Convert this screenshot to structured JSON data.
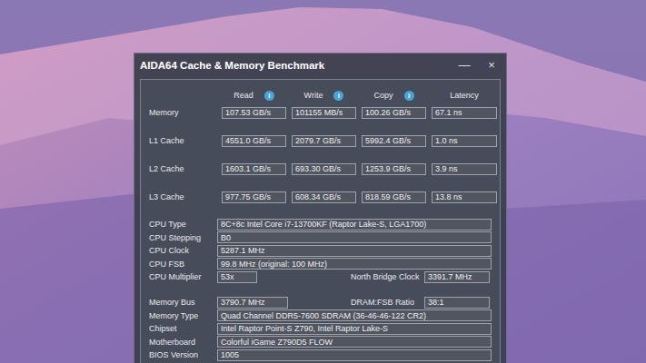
{
  "window": {
    "title": "AIDA64 Cache & Memory Benchmark",
    "controls": [
      "—",
      "×"
    ]
  },
  "columns": [
    {
      "label": "Read",
      "info": "i"
    },
    {
      "label": "Write",
      "info": "i"
    },
    {
      "label": "Copy",
      "info": "i"
    },
    {
      "label": "Latency",
      "info": ""
    }
  ],
  "rows": [
    {
      "label": "Memory",
      "values": [
        "107.53 GB/s",
        "101155 MB/s",
        "100.26 GB/s",
        "67.1 ns"
      ]
    },
    {
      "label": "L1 Cache",
      "values": [
        "4551.0 GB/s",
        "2079.7 GB/s",
        "5992.4 GB/s",
        "1.0 ns"
      ]
    },
    {
      "label": "L2 Cache",
      "values": [
        "1603.1 GB/s",
        "693.30 GB/s",
        "1253.9 GB/s",
        "3.9 ns"
      ]
    },
    {
      "label": "L3 Cache",
      "values": [
        "977.75 GB/s",
        "608.34 GB/s",
        "818.59 GB/s",
        "13.8 ns"
      ]
    }
  ],
  "info_groups": [
    [
      {
        "kind": "wide",
        "label": "CPU Type",
        "value": "8C+8c Intel Core i7-13700KF  (Raptor Lake-S, LGA1700)"
      },
      {
        "kind": "wide",
        "label": "CPU Stepping",
        "value": "B0"
      },
      {
        "kind": "wide",
        "label": "CPU Clock",
        "value": "5287.1 MHz"
      },
      {
        "kind": "wide",
        "label": "CPU FSB",
        "value": "99.8 MHz  (original: 100 MHz)"
      },
      {
        "kind": "pair",
        "label": "CPU Multiplier",
        "value": "53x",
        "label2": "North Bridge Clock",
        "value2": "3391.7 MHz"
      }
    ],
    [
      {
        "kind": "pair",
        "label": "Memory Bus",
        "value": "3790.7 MHz",
        "label2": "DRAM:FSB Ratio",
        "value2": "38:1"
      },
      {
        "kind": "wide",
        "label": "Memory Type",
        "value": "Quad Channel DDR5-7600 SDRAM  (36-46-46-122 CR2)"
      },
      {
        "kind": "wide",
        "label": "Chipset",
        "value": "Intel Raptor Point-S Z790, Intel Raptor Lake-S"
      },
      {
        "kind": "wide",
        "label": "Motherboard",
        "value": "Colorful iGame Z790D5 FLOW"
      },
      {
        "kind": "wide",
        "label": "BIOS Version",
        "value": "1005"
      }
    ]
  ]
}
